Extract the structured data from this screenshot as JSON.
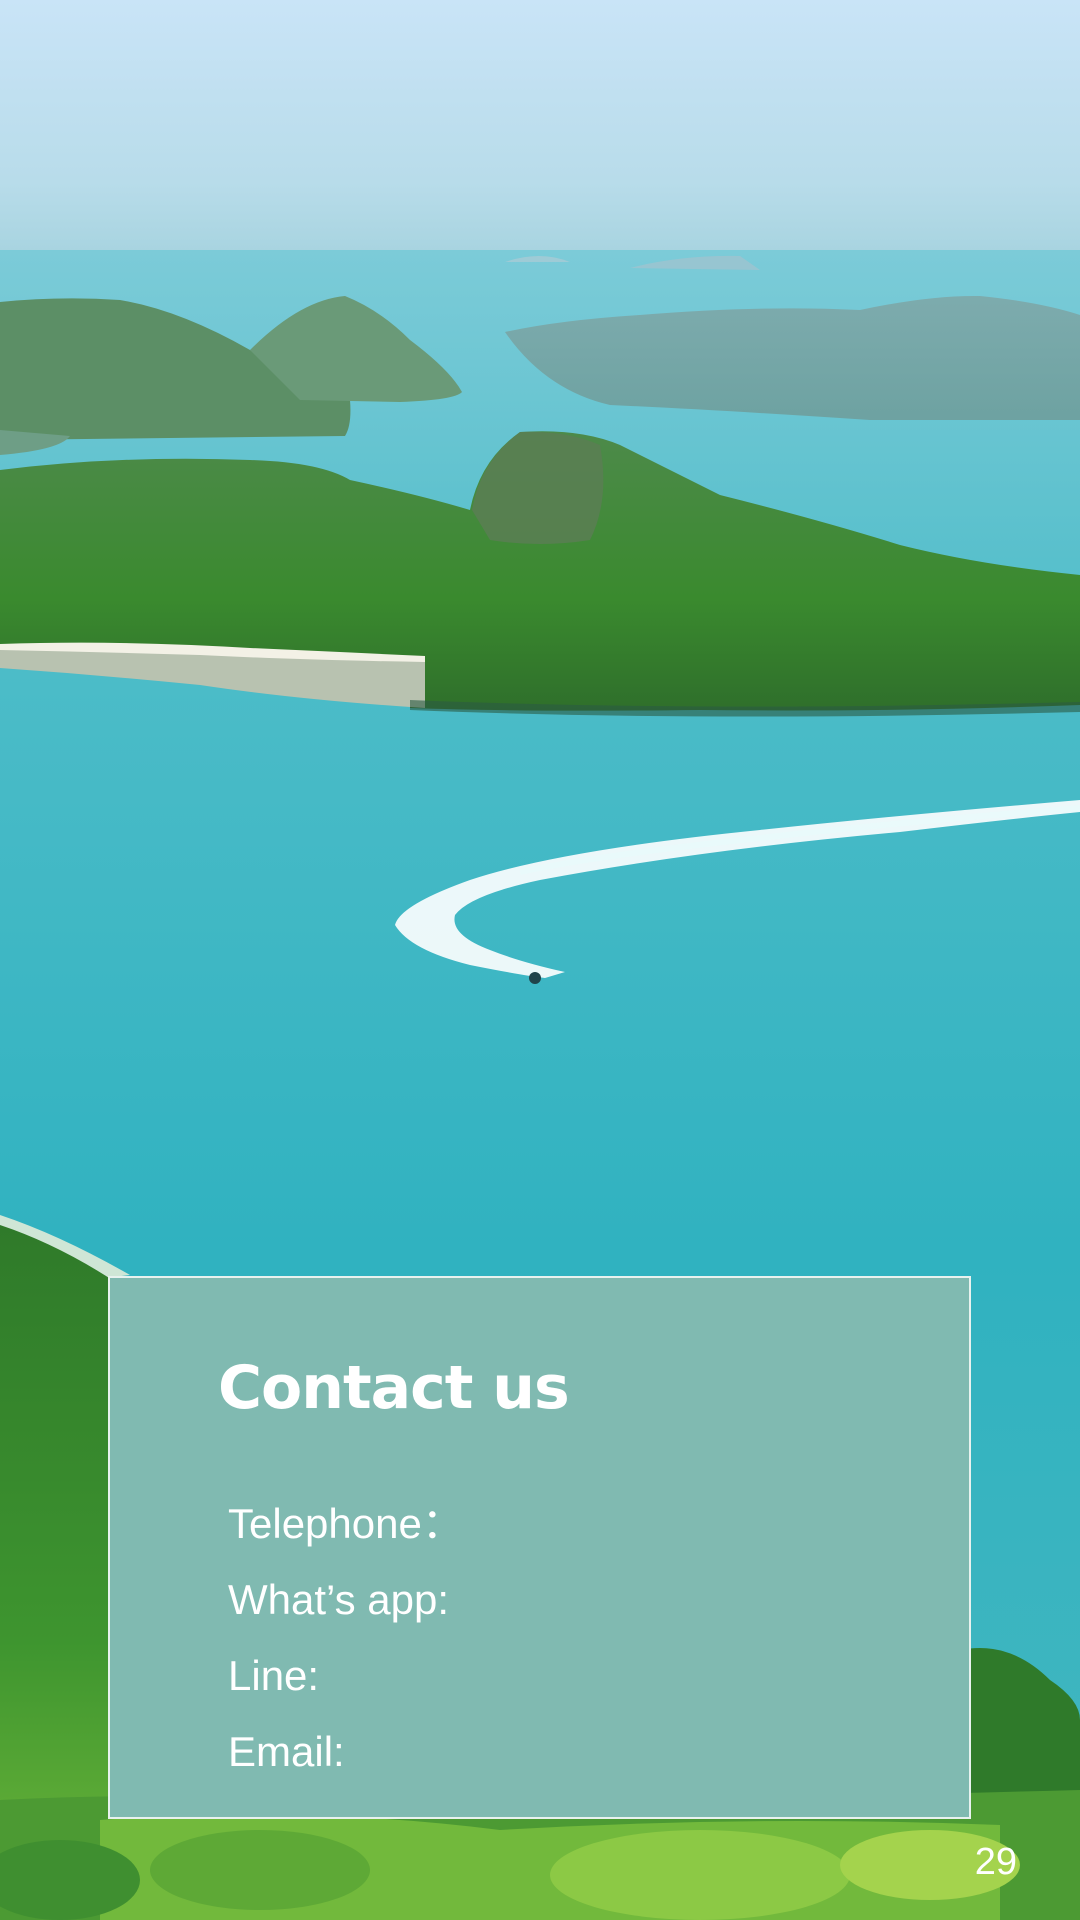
{
  "contact": {
    "title": "Contact us",
    "items": [
      {
        "label": "Telephone："
      },
      {
        "label": "What’s app:"
      },
      {
        "label": "Line:"
      },
      {
        "label": "Email:"
      }
    ]
  },
  "page": {
    "number": "29"
  },
  "colors": {
    "card_background": "#80bab1",
    "card_border": "#e8f2ef",
    "text": "#ffffff",
    "sea": "#39b5c3",
    "sky": "#c9e4f5",
    "foliage": "#3f8f38"
  }
}
